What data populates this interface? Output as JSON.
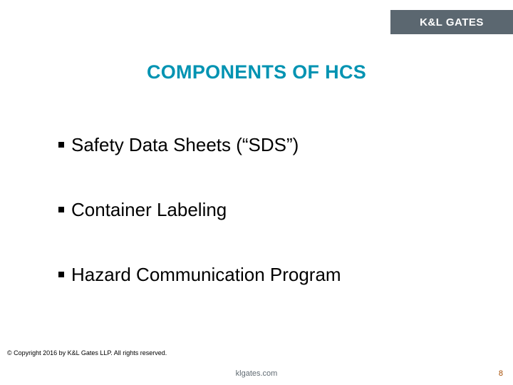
{
  "brand": {
    "logo_text": "K&L GATES"
  },
  "slide": {
    "title": "COMPONENTS OF HCS",
    "bullets": [
      "Safety Data Sheets (“SDS”)",
      "Container Labeling",
      "Hazard Communication Program"
    ]
  },
  "footer": {
    "copyright": "© Copyright 2016 by K&L Gates LLP. All rights reserved.",
    "site": "klgates.com",
    "page_number": "8"
  }
}
